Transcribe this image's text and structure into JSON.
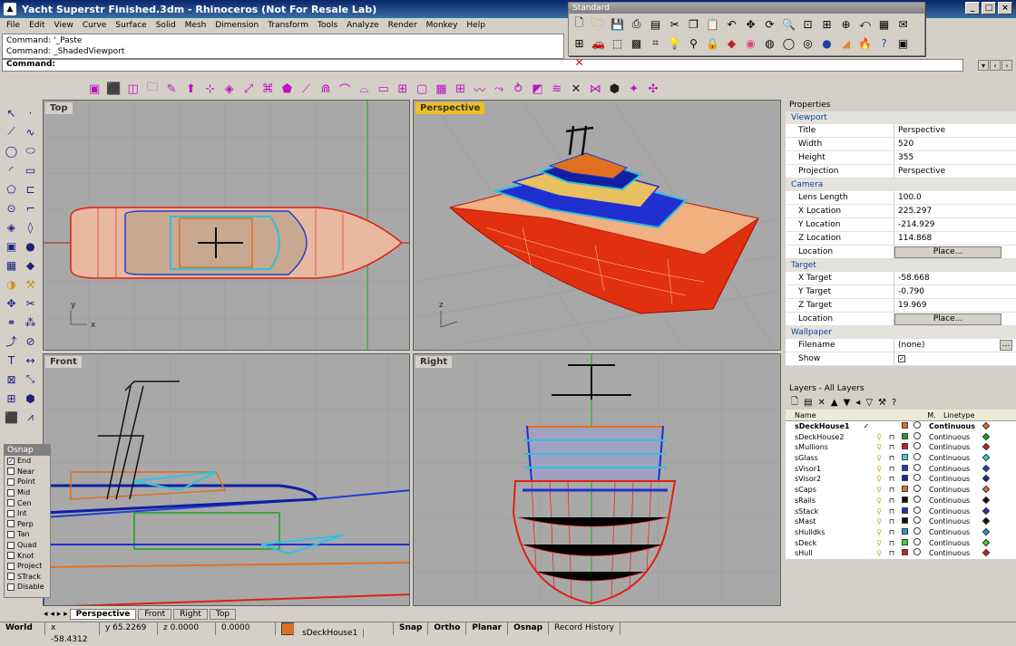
{
  "window": {
    "title": "Yacht Superstr Finished.3dm - Rhinoceros (Not For Resale Lab)"
  },
  "menu": [
    "File",
    "Edit",
    "View",
    "Curve",
    "Surface",
    "Solid",
    "Mesh",
    "Dimension",
    "Transform",
    "Tools",
    "Analyze",
    "Render",
    "Monkey",
    "Help"
  ],
  "command": {
    "history1": "Command: '_Paste",
    "history2": "Command: _ShadedViewport",
    "prompt": "Command:"
  },
  "standard_toolbar": {
    "title": "Standard"
  },
  "viewports": {
    "top": "Top",
    "perspective": "Perspective",
    "front": "Front",
    "right": "Right"
  },
  "osnap": {
    "title": "Osnap",
    "items": [
      {
        "label": "End",
        "checked": true
      },
      {
        "label": "Near",
        "checked": false
      },
      {
        "label": "Point",
        "checked": false
      },
      {
        "label": "Mid",
        "checked": false
      },
      {
        "label": "Cen",
        "checked": false
      },
      {
        "label": "Int",
        "checked": false
      },
      {
        "label": "Perp",
        "checked": false
      },
      {
        "label": "Tan",
        "checked": false
      },
      {
        "label": "Quad",
        "checked": false
      },
      {
        "label": "Knot",
        "checked": false
      },
      {
        "label": "Project",
        "checked": false
      },
      {
        "label": "STrack",
        "checked": false
      },
      {
        "label": "Disable",
        "checked": false
      }
    ]
  },
  "tabs": [
    "Perspective",
    "Front",
    "Right",
    "Top"
  ],
  "status": {
    "world": "World",
    "x": "x -58.4312",
    "y": "y 65.2269",
    "z": "z 0.0000",
    "d": "0.0000",
    "layer": "sDeckHouse1",
    "snap": "Snap",
    "ortho": "Ortho",
    "planar": "Planar",
    "osnap": "Osnap",
    "history": "Record History"
  },
  "properties": {
    "title": "Properties",
    "viewport_section": "Viewport",
    "viewport": [
      [
        "Title",
        "Perspective"
      ],
      [
        "Width",
        "520"
      ],
      [
        "Height",
        "355"
      ],
      [
        "Projection",
        "Perspective"
      ]
    ],
    "camera_section": "Camera",
    "camera": [
      [
        "Lens Length",
        "100.0"
      ],
      [
        "X Location",
        "225.297"
      ],
      [
        "Y Location",
        "-214.929"
      ],
      [
        "Z Location",
        "114.868"
      ]
    ],
    "location_label": "Location",
    "place_label": "Place...",
    "target_section": "Target",
    "target": [
      [
        "X Target",
        "-58.668"
      ],
      [
        "Y Target",
        "-0.790"
      ],
      [
        "Z Target",
        "19.969"
      ]
    ],
    "wallpaper_section": "Wallpaper",
    "filename_label": "Filename",
    "filename_value": "(none)",
    "show_label": "Show"
  },
  "layers": {
    "title": "Layers - All Layers",
    "headers": {
      "name": "Name",
      "m": "M.",
      "linetype": "Linetype"
    },
    "rows": [
      {
        "name": "sDeckHouse1",
        "color": "#e07020",
        "linetype": "Continuous",
        "current": true
      },
      {
        "name": "sDeckHouse2",
        "color": "#20a020",
        "linetype": "Continuous"
      },
      {
        "name": "sMullions",
        "color": "#c02020",
        "linetype": "Continuous"
      },
      {
        "name": "sGlass",
        "color": "#40d0e0",
        "linetype": "Continuous"
      },
      {
        "name": "sVisor1",
        "color": "#2040c0",
        "linetype": "Continuous"
      },
      {
        "name": "sVisor2",
        "color": "#2020a0",
        "linetype": "Continuous"
      },
      {
        "name": "sCaps",
        "color": "#e07020",
        "linetype": "Continuous"
      },
      {
        "name": "sRails",
        "color": "#101010",
        "linetype": "Continuous"
      },
      {
        "name": "sStack",
        "color": "#2030c0",
        "linetype": "Continuous"
      },
      {
        "name": "sMast",
        "color": "#101010",
        "linetype": "Continuous"
      },
      {
        "name": "sHulldks",
        "color": "#3090e0",
        "linetype": "Continuous"
      },
      {
        "name": "sDeck",
        "color": "#40d040",
        "linetype": "Continuous"
      },
      {
        "name": "sHull",
        "color": "#d02020",
        "linetype": "Continuous"
      }
    ]
  }
}
